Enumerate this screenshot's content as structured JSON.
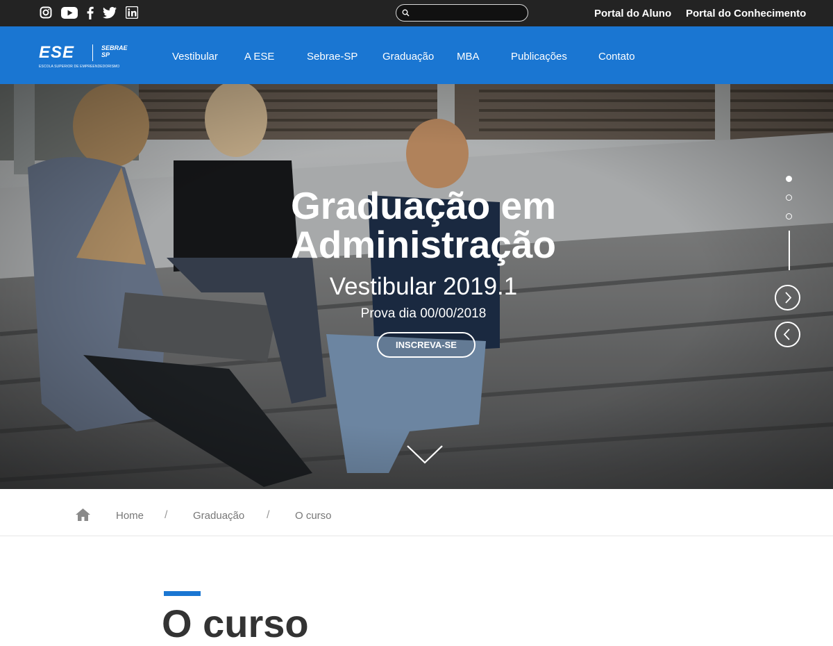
{
  "colors": {
    "topbar": "#232323",
    "brand_blue": "#1a76d2",
    "text_gray": "#777777"
  },
  "topbar": {
    "social_icons": [
      "instagram-icon",
      "youtube-icon",
      "facebook-icon",
      "twitter-icon",
      "linkedin-icon"
    ],
    "search": {
      "value": "",
      "placeholder": ""
    },
    "links": [
      "Portal do Aluno",
      "Portal do Conhecimento"
    ]
  },
  "logo": {
    "text": "ESE",
    "partner": "SEBRAE SP",
    "subtitle": "ESCOLA SUPERIOR DE EMPREENDEDORISMO"
  },
  "nav": {
    "items": [
      "Vestibular",
      "A ESE",
      "Sebrae-SP",
      "Graduação",
      "MBA",
      "Publicações",
      "Contato"
    ]
  },
  "hero": {
    "title_line1": "Graduação em",
    "title_line2": "Administração",
    "subtitle": "Vestibular 2019.1",
    "date": "Prova dia 00/00/2018",
    "cta": "INSCREVA-SE",
    "slides_total": 3,
    "slide_active": 1
  },
  "breadcrumb": {
    "items": [
      "Home",
      "Graduação",
      "O curso"
    ],
    "separator": "/"
  },
  "section": {
    "title": "O curso"
  }
}
